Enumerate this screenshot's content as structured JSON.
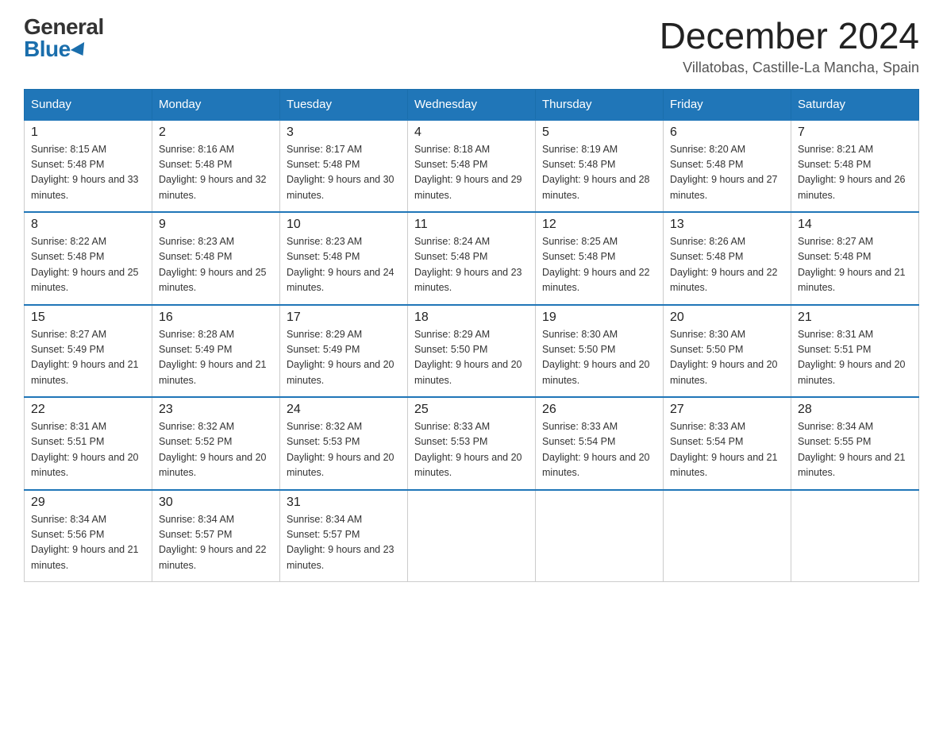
{
  "logo": {
    "general": "General",
    "blue": "Blue"
  },
  "title": "December 2024",
  "location": "Villatobas, Castille-La Mancha, Spain",
  "days_of_week": [
    "Sunday",
    "Monday",
    "Tuesday",
    "Wednesday",
    "Thursday",
    "Friday",
    "Saturday"
  ],
  "weeks": [
    [
      {
        "day": "1",
        "sunrise": "8:15 AM",
        "sunset": "5:48 PM",
        "daylight": "9 hours and 33 minutes."
      },
      {
        "day": "2",
        "sunrise": "8:16 AM",
        "sunset": "5:48 PM",
        "daylight": "9 hours and 32 minutes."
      },
      {
        "day": "3",
        "sunrise": "8:17 AM",
        "sunset": "5:48 PM",
        "daylight": "9 hours and 30 minutes."
      },
      {
        "day": "4",
        "sunrise": "8:18 AM",
        "sunset": "5:48 PM",
        "daylight": "9 hours and 29 minutes."
      },
      {
        "day": "5",
        "sunrise": "8:19 AM",
        "sunset": "5:48 PM",
        "daylight": "9 hours and 28 minutes."
      },
      {
        "day": "6",
        "sunrise": "8:20 AM",
        "sunset": "5:48 PM",
        "daylight": "9 hours and 27 minutes."
      },
      {
        "day": "7",
        "sunrise": "8:21 AM",
        "sunset": "5:48 PM",
        "daylight": "9 hours and 26 minutes."
      }
    ],
    [
      {
        "day": "8",
        "sunrise": "8:22 AM",
        "sunset": "5:48 PM",
        "daylight": "9 hours and 25 minutes."
      },
      {
        "day": "9",
        "sunrise": "8:23 AM",
        "sunset": "5:48 PM",
        "daylight": "9 hours and 25 minutes."
      },
      {
        "day": "10",
        "sunrise": "8:23 AM",
        "sunset": "5:48 PM",
        "daylight": "9 hours and 24 minutes."
      },
      {
        "day": "11",
        "sunrise": "8:24 AM",
        "sunset": "5:48 PM",
        "daylight": "9 hours and 23 minutes."
      },
      {
        "day": "12",
        "sunrise": "8:25 AM",
        "sunset": "5:48 PM",
        "daylight": "9 hours and 22 minutes."
      },
      {
        "day": "13",
        "sunrise": "8:26 AM",
        "sunset": "5:48 PM",
        "daylight": "9 hours and 22 minutes."
      },
      {
        "day": "14",
        "sunrise": "8:27 AM",
        "sunset": "5:48 PM",
        "daylight": "9 hours and 21 minutes."
      }
    ],
    [
      {
        "day": "15",
        "sunrise": "8:27 AM",
        "sunset": "5:49 PM",
        "daylight": "9 hours and 21 minutes."
      },
      {
        "day": "16",
        "sunrise": "8:28 AM",
        "sunset": "5:49 PM",
        "daylight": "9 hours and 21 minutes."
      },
      {
        "day": "17",
        "sunrise": "8:29 AM",
        "sunset": "5:49 PM",
        "daylight": "9 hours and 20 minutes."
      },
      {
        "day": "18",
        "sunrise": "8:29 AM",
        "sunset": "5:50 PM",
        "daylight": "9 hours and 20 minutes."
      },
      {
        "day": "19",
        "sunrise": "8:30 AM",
        "sunset": "5:50 PM",
        "daylight": "9 hours and 20 minutes."
      },
      {
        "day": "20",
        "sunrise": "8:30 AM",
        "sunset": "5:50 PM",
        "daylight": "9 hours and 20 minutes."
      },
      {
        "day": "21",
        "sunrise": "8:31 AM",
        "sunset": "5:51 PM",
        "daylight": "9 hours and 20 minutes."
      }
    ],
    [
      {
        "day": "22",
        "sunrise": "8:31 AM",
        "sunset": "5:51 PM",
        "daylight": "9 hours and 20 minutes."
      },
      {
        "day": "23",
        "sunrise": "8:32 AM",
        "sunset": "5:52 PM",
        "daylight": "9 hours and 20 minutes."
      },
      {
        "day": "24",
        "sunrise": "8:32 AM",
        "sunset": "5:53 PM",
        "daylight": "9 hours and 20 minutes."
      },
      {
        "day": "25",
        "sunrise": "8:33 AM",
        "sunset": "5:53 PM",
        "daylight": "9 hours and 20 minutes."
      },
      {
        "day": "26",
        "sunrise": "8:33 AM",
        "sunset": "5:54 PM",
        "daylight": "9 hours and 20 minutes."
      },
      {
        "day": "27",
        "sunrise": "8:33 AM",
        "sunset": "5:54 PM",
        "daylight": "9 hours and 21 minutes."
      },
      {
        "day": "28",
        "sunrise": "8:34 AM",
        "sunset": "5:55 PM",
        "daylight": "9 hours and 21 minutes."
      }
    ],
    [
      {
        "day": "29",
        "sunrise": "8:34 AM",
        "sunset": "5:56 PM",
        "daylight": "9 hours and 21 minutes."
      },
      {
        "day": "30",
        "sunrise": "8:34 AM",
        "sunset": "5:57 PM",
        "daylight": "9 hours and 22 minutes."
      },
      {
        "day": "31",
        "sunrise": "8:34 AM",
        "sunset": "5:57 PM",
        "daylight": "9 hours and 23 minutes."
      },
      null,
      null,
      null,
      null
    ]
  ]
}
